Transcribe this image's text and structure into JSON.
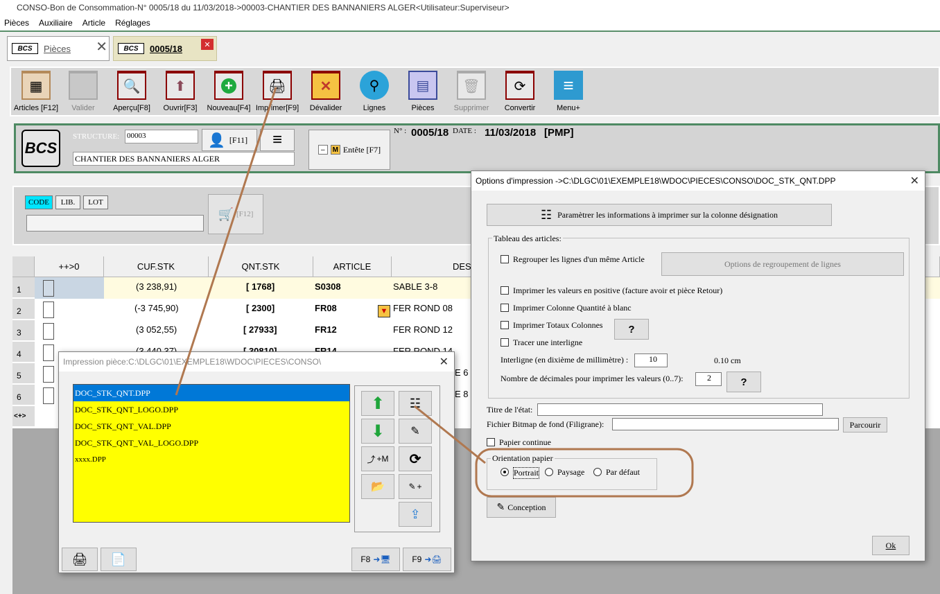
{
  "window": {
    "title": "CONSO-Bon de Consommation-N° 0005/18 du 11/03/2018->00003-CHANTIER DES BANNANIERS ALGER<Utilisateur:Superviseur>"
  },
  "menu": [
    "Pièces",
    "Auxiliaire",
    "Article",
    "Réglages"
  ],
  "tabs": [
    {
      "icon_text": "BCS",
      "label": "Pièces"
    },
    {
      "icon_text": "BCS",
      "label": "0005/18"
    }
  ],
  "toolbar": [
    {
      "label": "Articles [F12]",
      "icon": "grid-icon"
    },
    {
      "label": "Valider",
      "icon": "blank-icon"
    },
    {
      "label": "Aperçu[F8]",
      "icon": "magnifier-icon"
    },
    {
      "label": "Ouvrir[F3]",
      "icon": "arrow-up-icon"
    },
    {
      "label": "Nouveau[F4]",
      "icon": "plus-icon"
    },
    {
      "label": "Imprimer[F9]",
      "icon": "printer-icon"
    },
    {
      "label": "Dévalider",
      "icon": "x-icon"
    },
    {
      "label": "Lignes",
      "icon": "search-icon"
    },
    {
      "label": "Pièces",
      "icon": "table-icon"
    },
    {
      "label": "Supprimer",
      "icon": "trash-icon"
    },
    {
      "label": "Convertir",
      "icon": "refresh-icon"
    },
    {
      "label": "Menu+",
      "icon": "menu-icon"
    }
  ],
  "header": {
    "logo": "BCS",
    "structure_label": "STRUCTURE:",
    "structure_code": "00003",
    "structure_name": "CHANTIER DES BANNANIERS ALGER",
    "f11": "[F11]",
    "entete_m": "M",
    "entete": "Entête [F7]",
    "num_label": "N° :",
    "num": "0005/18",
    "date_label": "DATE :",
    "date": "11/03/2018",
    "pmp": "[PMP]"
  },
  "search": {
    "code": "CODE",
    "lib": "LIB.",
    "lot": "LOT",
    "f12": "[F12]"
  },
  "grid": {
    "headers": [
      "++>0",
      "CUF.STK",
      "QNT.STK",
      "ARTICLE",
      "DES"
    ],
    "rows": [
      {
        "n": "1",
        "cuf": "(3 238,91)",
        "qnt": "[ 1768]",
        "article": "S0308",
        "des": "SABLE 3-8"
      },
      {
        "n": "2",
        "cuf": "(-3 745,90)",
        "qnt": "[ 2300]",
        "article": "FR08",
        "des": "FER ROND 08"
      },
      {
        "n": "3",
        "cuf": "(3 052,55)",
        "qnt": "[ 27933]",
        "article": "FR12",
        "des": "FER ROND 12"
      },
      {
        "n": "4",
        "cuf": "(3 440,37)",
        "qnt": "[ 30810]",
        "article": "FR14",
        "des": "FER ROND 14"
      },
      {
        "n": "5",
        "cuf": "",
        "qnt": "",
        "article": "",
        "des": "E 6"
      },
      {
        "n": "6",
        "cuf": "",
        "qnt": "",
        "article": "",
        "des": "E 8"
      }
    ],
    "footer": "<+>"
  },
  "print_dialog": {
    "title": "Impression pièce:C:\\DLGC\\01\\EXEMPLE18\\WDOC\\PIECES\\CONSO\\",
    "files": [
      "DOC_STK_QNT.DPP",
      "DOC_STK_QNT_LOGO.DPP",
      "DOC_STK_QNT_VAL.DPP",
      "DOC_STK_QNT_VAL_LOGO.DPP",
      "xxxx.DPP"
    ],
    "plus_m": "+M",
    "plus": "+",
    "f8": "F8",
    "f9": "F9"
  },
  "options_dialog": {
    "title": "Options d'impression ->C:\\DLGC\\01\\EXEMPLE18\\WDOC\\PIECES\\CONSO\\DOC_STK_QNT.DPP",
    "param_btn": "Paramètrer les informations à imprimer sur la colonne désignation",
    "group_label": "Tableau des articles:",
    "regrouper": "Regrouper les lignes d'un même Article",
    "options_regroupement": "Options de regroupement de lignes",
    "valeurs_positive": "Imprimer les valeurs en positive (facture avoir et pièce Retour)",
    "qte_blanc": "Imprimer Colonne Quantité à blanc",
    "totaux": "Imprimer Totaux Colonnes",
    "q": "?",
    "interligne_chk": "Tracer une interligne",
    "interligne_lbl": "Interligne (en dixième de millimètre) :",
    "interligne_val": "10",
    "interligne_cm": "0.10 cm",
    "decimales_lbl": "Nombre de décimales pour imprimer les valeurs (0..7):",
    "decimales_val": "2",
    "titre_lbl": "Titre de l'état:",
    "bitmap_lbl": "Fichier Bitmap de fond (Filigrane):",
    "parcourir": "Parcourir",
    "papier_continue": "Papier continue",
    "orientation_lbl": "Orientation papier",
    "portrait": "Portrait",
    "paysage": "Paysage",
    "par_defaut": "Par défaut",
    "conception": "Conception",
    "ok": "Ok"
  },
  "colors": {
    "accent_green": "#4e8a63",
    "selection_blue": "#0078d7",
    "list_yellow": "#ffff00",
    "annotation_brown": "#b07850",
    "row1_bg": "#fffbe0"
  }
}
